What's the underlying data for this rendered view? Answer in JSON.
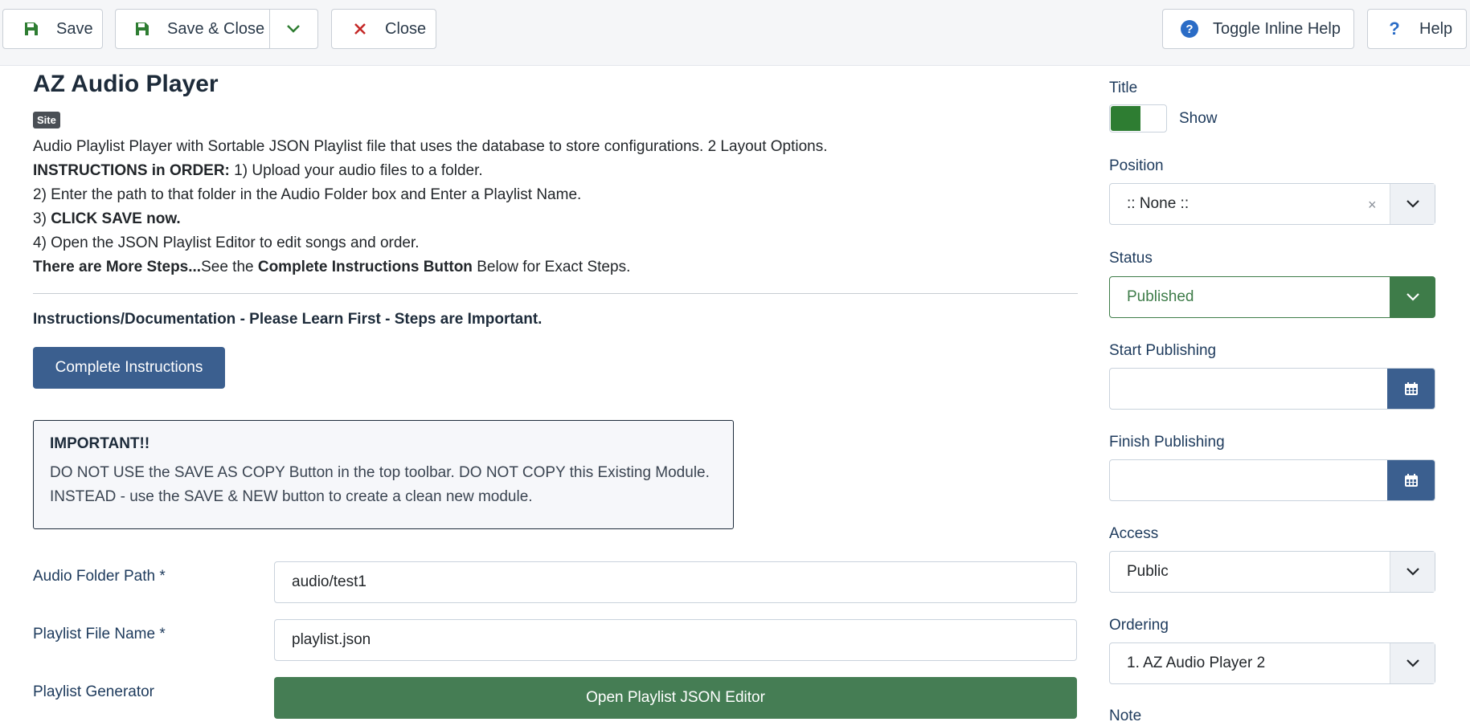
{
  "toolbar": {
    "save_label": "Save",
    "save_close_label": "Save & Close",
    "close_label": "Close",
    "toggle_help_label": "Toggle Inline Help",
    "help_label": "Help",
    "help_glyph": "?"
  },
  "module": {
    "title": "AZ Audio Player",
    "badge": "Site",
    "description_line1": "Audio Playlist Player with Sortable JSON Playlist file that uses the database to store configurations. 2 Layout Options.",
    "instructions_bold": "INSTRUCTIONS in ORDER:",
    "instructions_step1": " 1) Upload your audio files to a folder.",
    "instructions_step2": "2) Enter the path to that folder in the Audio Folder box and Enter a Playlist Name.",
    "instructions_step3_prefix": "3) ",
    "instructions_step3_bold": "CLICK SAVE now.",
    "instructions_step4": "4) Open the JSON Playlist Editor to edit songs and order.",
    "more_steps_bold": "There are More Steps...",
    "more_steps_text1": "See the ",
    "more_steps_bold2": "Complete Instructions Button",
    "more_steps_text2": " Below for Exact Steps.",
    "docs_heading": "Instructions/Documentation - Please Learn First - Steps are Important.",
    "complete_button": "Complete Instructions",
    "important_title": "IMPORTANT!!",
    "important_line1": "DO NOT USE the SAVE AS COPY Button in the top toolbar. DO NOT COPY this Existing Module.",
    "important_line2": "INSTEAD - use the SAVE & NEW button to create a clean new module."
  },
  "fields": {
    "audio_folder_label": "Audio Folder Path *",
    "audio_folder_value": "audio/test1",
    "playlist_file_label": "Playlist File Name *",
    "playlist_file_value": "playlist.json",
    "playlist_generator_label": "Playlist Generator",
    "playlist_generator_button": "Open Playlist JSON Editor"
  },
  "sidebar": {
    "title_label": "Title",
    "title_toggle_text": "Show",
    "position_label": "Position",
    "position_value": ":: None ::",
    "position_clear": "×",
    "status_label": "Status",
    "status_value": "Published",
    "start_publishing_label": "Start Publishing",
    "finish_publishing_label": "Finish Publishing",
    "access_label": "Access",
    "access_value": "Public",
    "ordering_label": "Ordering",
    "ordering_value": "1. AZ Audio Player 2",
    "note_label": "Note"
  },
  "colors": {
    "primary_blue": "#3b5f8f",
    "success_green": "#457d54",
    "status_green": "#3e7c49",
    "toggle_green": "#2e7d32",
    "close_red": "#c52827",
    "help_blue": "#2a6cc6"
  },
  "icons": {
    "save": "floppy-disk-icon",
    "dropdown": "chevron-down-icon",
    "close": "x-icon",
    "inline_help": "question-circle-icon",
    "help": "question-icon",
    "calendar": "calendar-icon"
  }
}
